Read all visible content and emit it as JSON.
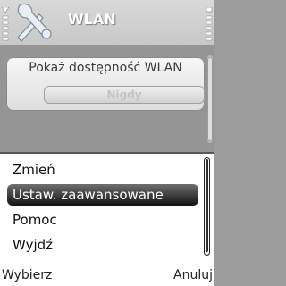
{
  "header": {
    "title": "WLAN",
    "app_icon": "tools-icon"
  },
  "setting": {
    "label": "Pokaż dostępność WLAN",
    "value": "Nigdy"
  },
  "menu": {
    "items": [
      {
        "label": "Zmień",
        "selected": false
      },
      {
        "label": "Ustaw. zaawansowane",
        "selected": true
      },
      {
        "label": "Pomoc",
        "selected": false
      },
      {
        "label": "Wyjdź",
        "selected": false
      }
    ]
  },
  "softkeys": {
    "left": "Wybierz",
    "right": "Anuluj"
  },
  "colors": {
    "selected_bg_top": "#6f6f6f",
    "selected_bg_bottom": "#121212",
    "background": "#9c9c9c"
  }
}
